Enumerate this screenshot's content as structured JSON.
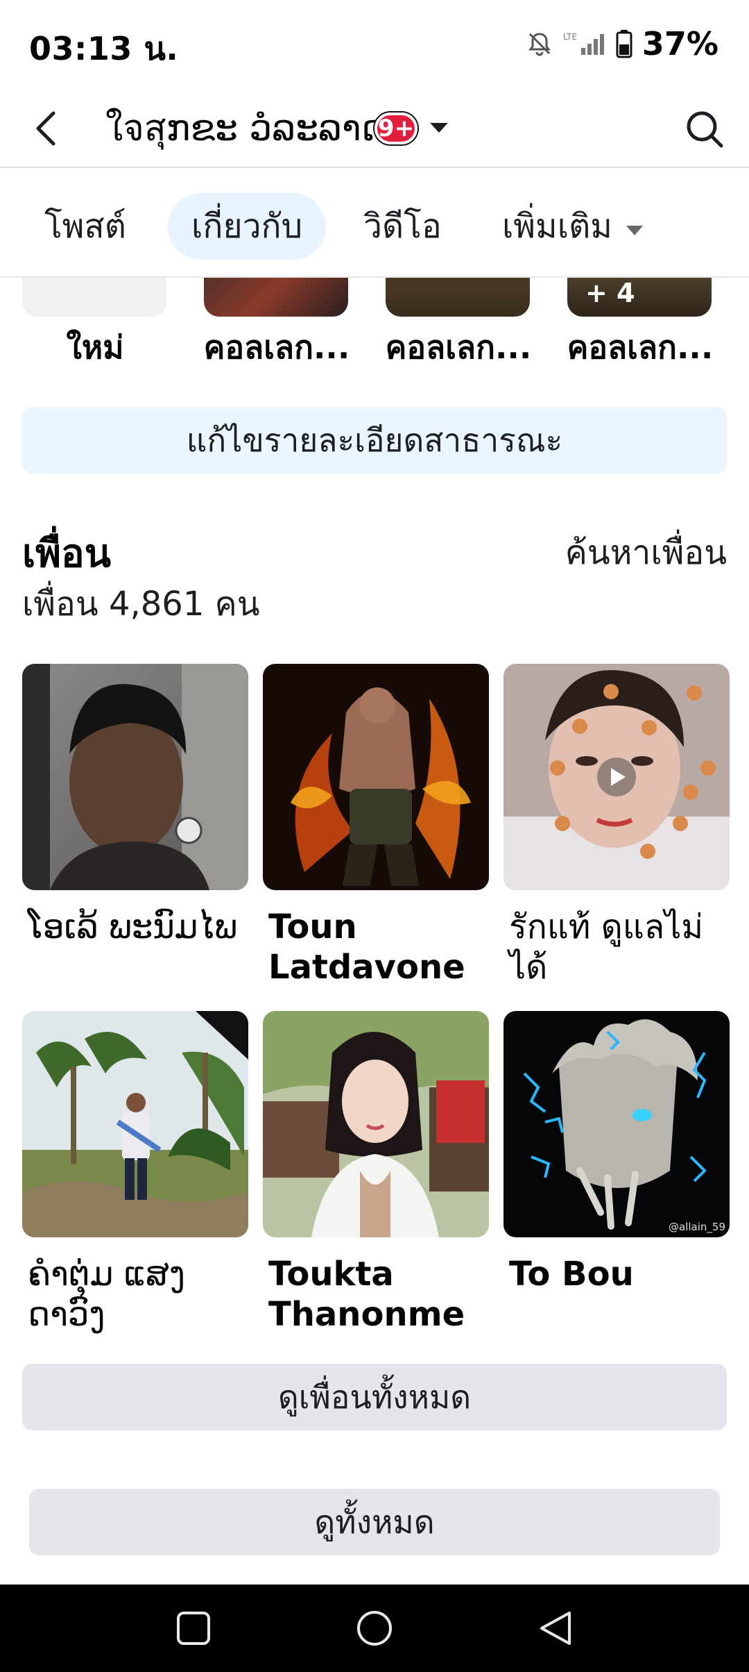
{
  "status_bar": {
    "time": "03:13 น.",
    "battery": "37%",
    "icons": [
      "mute-bell-icon",
      "lte-signal-icon",
      "battery-icon"
    ]
  },
  "header": {
    "title": "ใจสุກຂະ ວໍລະລາດ",
    "badge": "9+",
    "icons": [
      "back-arrow-icon",
      "caret-down-icon",
      "search-icon"
    ]
  },
  "tabs": [
    {
      "label": "โพสต์",
      "active": false
    },
    {
      "label": "เกี่ยวกับ",
      "active": true
    },
    {
      "label": "วิดีโอ",
      "active": false
    },
    {
      "label": "เพิ่มเติม",
      "active": false
    }
  ],
  "highlights": [
    {
      "label": "ใหม่"
    },
    {
      "label": "คอลเลก..."
    },
    {
      "label": "คอลเลก..."
    },
    {
      "label": "คอลเลก...",
      "overlay": "+ 4"
    }
  ],
  "edit_details_label": "แก้ไขรายละเอียดสาธารณะ",
  "friends": {
    "title": "เพื่อน",
    "find_link": "ค้นหาเพื่อน",
    "count_text": "เพื่อน 4,861 คน",
    "list": [
      {
        "name": "ໂອເລ້ ພະນົມໄພ"
      },
      {
        "name": "Toun Latdavone"
      },
      {
        "name": "รักแท้ ดูแลไม่ได้"
      },
      {
        "name": "ຄຳຕຸ່ມ ແສງດາວົງ"
      },
      {
        "name": "Toukta Thanonme"
      },
      {
        "name": "To Bou"
      }
    ],
    "watermark": "@allain_59",
    "see_all_label": "ดูเพื่อนทั้งหมด"
  },
  "see_all_label": "ดูทั้งหมด",
  "navbar": {
    "icons": [
      "recent-apps-icon",
      "home-icon",
      "back-triangle-icon"
    ]
  },
  "colors": {
    "active_tab_bg": "#e7f3ff",
    "edit_button_bg": "#ebf5ff",
    "secondary_button_bg": "#e4e6eb",
    "badge_red": "#e41e3f"
  }
}
